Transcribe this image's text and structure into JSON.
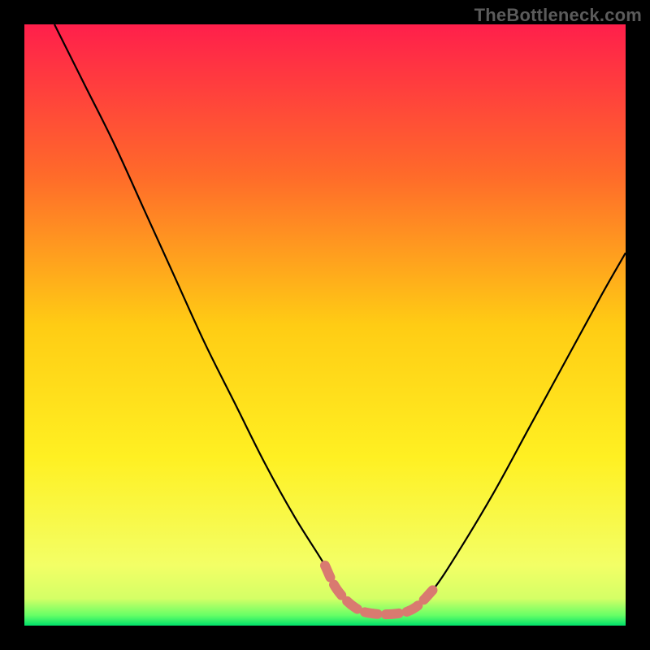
{
  "watermark": "TheBottleneck.com",
  "chart_data": {
    "type": "line",
    "title": "",
    "xlabel": "",
    "ylabel": "",
    "xlim": [
      0,
      100
    ],
    "ylim": [
      0,
      100
    ],
    "grid": false,
    "legend": false,
    "gradient": {
      "stops": [
        {
          "offset": 0.0,
          "color": "#ff1f4b"
        },
        {
          "offset": 0.25,
          "color": "#ff6a2a"
        },
        {
          "offset": 0.5,
          "color": "#ffcc14"
        },
        {
          "offset": 0.72,
          "color": "#fff022"
        },
        {
          "offset": 0.9,
          "color": "#f3ff66"
        },
        {
          "offset": 0.955,
          "color": "#d4ff66"
        },
        {
          "offset": 0.983,
          "color": "#66ff66"
        },
        {
          "offset": 1.0,
          "color": "#00e06a"
        }
      ]
    },
    "series": [
      {
        "name": "bottleneck-curve",
        "color": "#000000",
        "x": [
          5,
          10,
          15,
          20,
          25,
          30,
          35,
          40,
          45,
          50,
          52,
          55,
          58,
          62,
          65,
          68,
          72,
          78,
          84,
          90,
          96,
          100
        ],
        "y": [
          100,
          90,
          80,
          69,
          58,
          47,
          37,
          27,
          18,
          10,
          6,
          3,
          2,
          2,
          3,
          6,
          12,
          22,
          33,
          44,
          55,
          62
        ]
      },
      {
        "name": "highlight-band",
        "color": "#d97a70",
        "stroke_width": 12,
        "linecap": "round",
        "x": [
          50,
          52,
          55,
          58,
          62,
          65,
          68
        ],
        "y": [
          10,
          6,
          3,
          2,
          2,
          3,
          6
        ]
      }
    ]
  }
}
